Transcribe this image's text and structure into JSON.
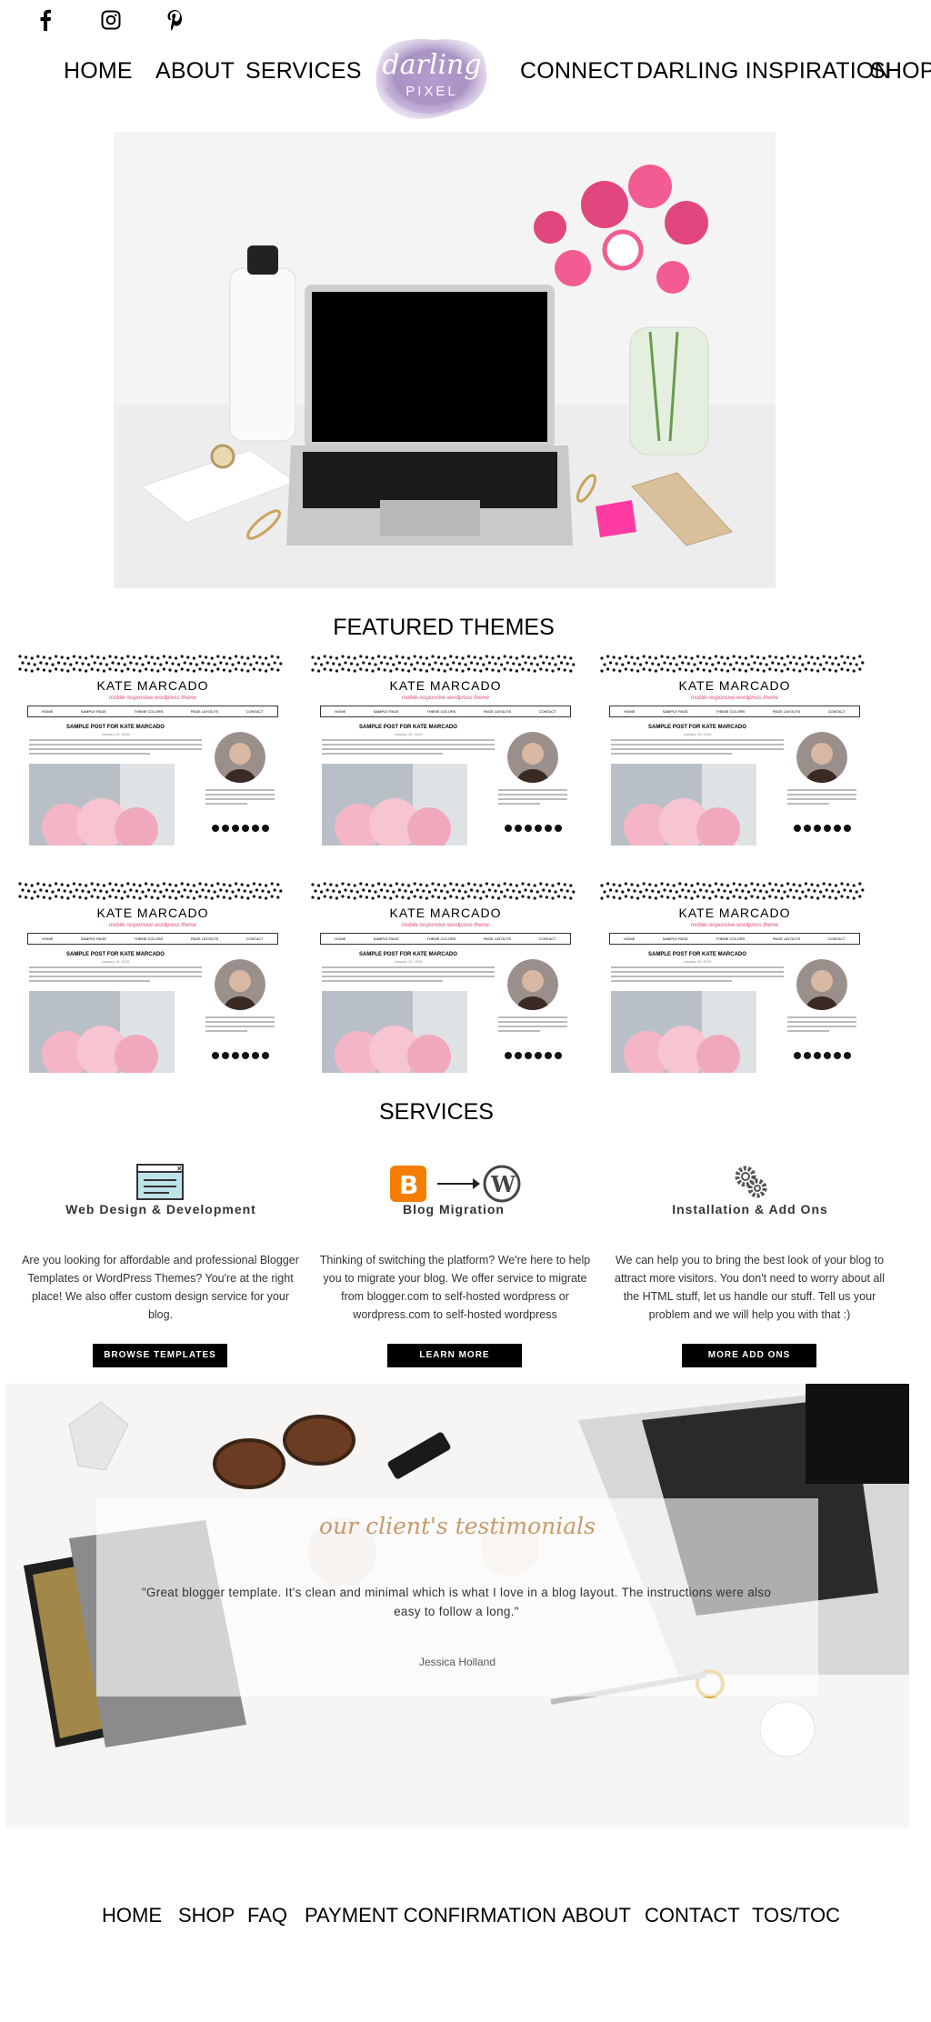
{
  "social": {
    "icons": [
      "facebook-icon",
      "instagram-icon",
      "pinterest-icon"
    ]
  },
  "nav": {
    "left": [
      "HOME",
      "ABOUT",
      "SERVICES"
    ],
    "right": [
      "CONNECT",
      "DARLING INSPIRATION",
      "SHOP"
    ]
  },
  "logo": {
    "line1": "darling",
    "line2": "PIXEL"
  },
  "featured": {
    "title": "FEATURED THEMES",
    "theme_name": "KATE MARCADO",
    "theme_tagline": "mobile responsive wordpress theme",
    "theme_nav": [
      "HOME",
      "SAMPLE PAGE",
      "THEME COLORS",
      "PAGE LAYOUTS",
      "CONTACT"
    ],
    "post_title": "SAMPLE POST FOR KATE MARCADO",
    "post_date": "January 19, 2015"
  },
  "services": {
    "title": "SERVICES",
    "items": [
      {
        "title": "Web Design & Development",
        "text": "Are you looking for affordable and professional Blogger Templates or WordPress Themes? You're at the right place! We also offer custom design service for your blog.",
        "button": "BROWSE TEMPLATES"
      },
      {
        "title": "Blog Migration",
        "text": "Thinking of switching the platform? We're here to help you to migrate your blog. We offer service to migrate from blogger.com to self-hosted wordpress or wordpress.com to self-hosted wordpress",
        "button": "LEARN MORE"
      },
      {
        "title": "Installation & Add Ons",
        "text": "We can help you to bring the best look of your blog to attract more visitors. You don't need to worry about all the HTML stuff, let us handle our stuff. Tell us your problem and we will help you with that :)",
        "button": "MORE ADD ONS"
      }
    ]
  },
  "testimonials": {
    "title": "our client's testimonials",
    "quote": "\"Great blogger template. It's clean and minimal which is what I love in a blog layout. The instructions were also easy to follow a long.\"",
    "author": "Jessica Holland"
  },
  "footer": {
    "links": [
      "HOME",
      "SHOP",
      "FAQ",
      "PAYMENT CONFIRMATION",
      "ABOUT",
      "CONTACT",
      "TOS/TOC"
    ]
  },
  "colors": {
    "accent": "#c79a6b",
    "button": "#000000",
    "logo": "#9b7fb8",
    "tagline": "#e0497e"
  }
}
